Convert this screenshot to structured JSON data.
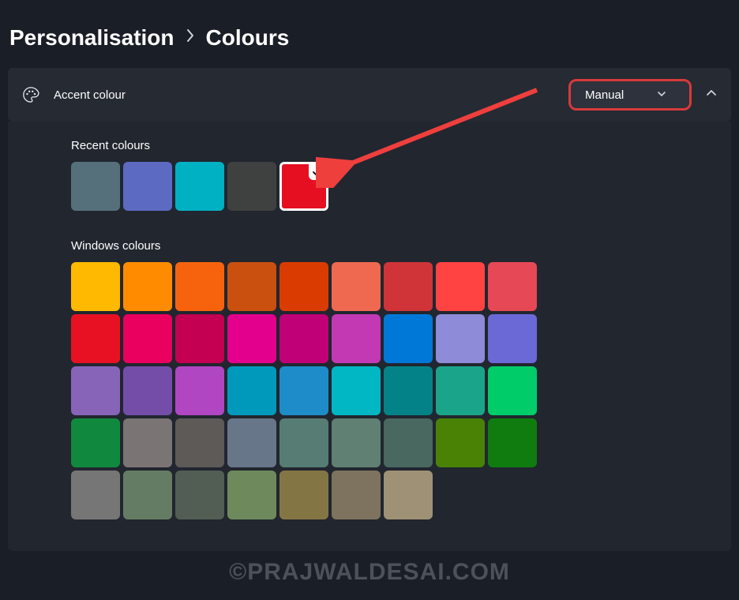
{
  "breadcrumb": {
    "parent": "Personalisation",
    "current": "Colours"
  },
  "section": {
    "title": "Accent colour",
    "dropdown_value": "Manual"
  },
  "recent": {
    "label": "Recent colours",
    "colors": [
      {
        "hex": "#55707a",
        "selected": false
      },
      {
        "hex": "#5d6ac1",
        "selected": false
      },
      {
        "hex": "#00b0c3",
        "selected": false
      },
      {
        "hex": "#3f4141",
        "selected": false
      },
      {
        "hex": "#e60f21",
        "selected": true
      }
    ]
  },
  "windows": {
    "label": "Windows colours",
    "colors": [
      "#ffb900",
      "#ff8c00",
      "#f7630c",
      "#ca5010",
      "#da3b01",
      "#ef6950",
      "#d13438",
      "#ff4343",
      "#e74856",
      "#e81123",
      "#ea005e",
      "#c30052",
      "#e3008c",
      "#bf0077",
      "#c239b3",
      "#0078d7",
      "#8e8cd8",
      "#6b69d6",
      "#8764b8",
      "#744da9",
      "#b146c2",
      "#0099bc",
      "#1d8cc8",
      "#00b7c3",
      "#038387",
      "#1aa58a",
      "#00cc6a",
      "#10893e",
      "#7a7574",
      "#5d5a58",
      "#68768a",
      "#567c73",
      "#5f8072",
      "#486860",
      "#498205",
      "#107c10",
      "#767676",
      "#647c64",
      "#525e54",
      "#6e8a5c",
      "#847545",
      "#7e735f",
      "#9e9176"
    ]
  },
  "watermark": "©PRAJWALDESAI.COM"
}
